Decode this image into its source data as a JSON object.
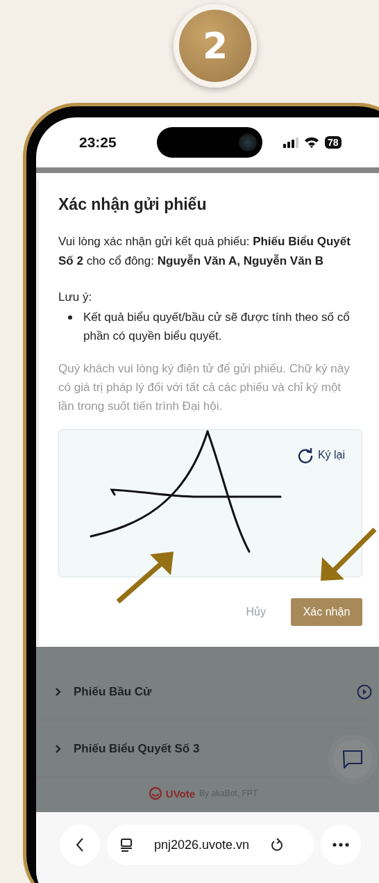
{
  "step_badge": "2",
  "status_bar": {
    "time": "23:25",
    "battery": "78"
  },
  "dialog": {
    "title": "Xác nhận gửi phiếu",
    "message": "Vui lòng xác nhận gửi kết quả phiếu: **Phiếu Biểu Quyết Số 2** cho cổ đông: **Nguyễn Văn A, Nguyễn Văn B**",
    "note_label": "Lưu ý:",
    "notes": [
      "Kết quả biểu quyết/bầu cử sẽ được tính theo số cổ phần có quyền biểu quyết."
    ],
    "instruction": "Quý khách vui lòng ký điện tử để gửi phiếu. Chữ ký này có giá trị pháp lý đối với tất cả các phiếu và chỉ ký một lần trong suốt tiến trình Đại hội.",
    "signature_pad": {
      "redo_label": "Ký lại"
    },
    "buttons": [
      {
        "label": "Hủy",
        "kind": "text"
      },
      {
        "label": "Xác nhận",
        "kind": "primary"
      }
    ]
  },
  "ballots": [
    {
      "title": "Phiếu Bầu Cử",
      "play_icon": true
    },
    {
      "title": "Phiếu Biểu Quyết Số 3",
      "play_icon": false
    }
  ],
  "footer": {
    "brand": "UVote",
    "credit": "By akaBot, FPT"
  },
  "browser": {
    "url": "pnj2026.uvote.vn"
  }
}
